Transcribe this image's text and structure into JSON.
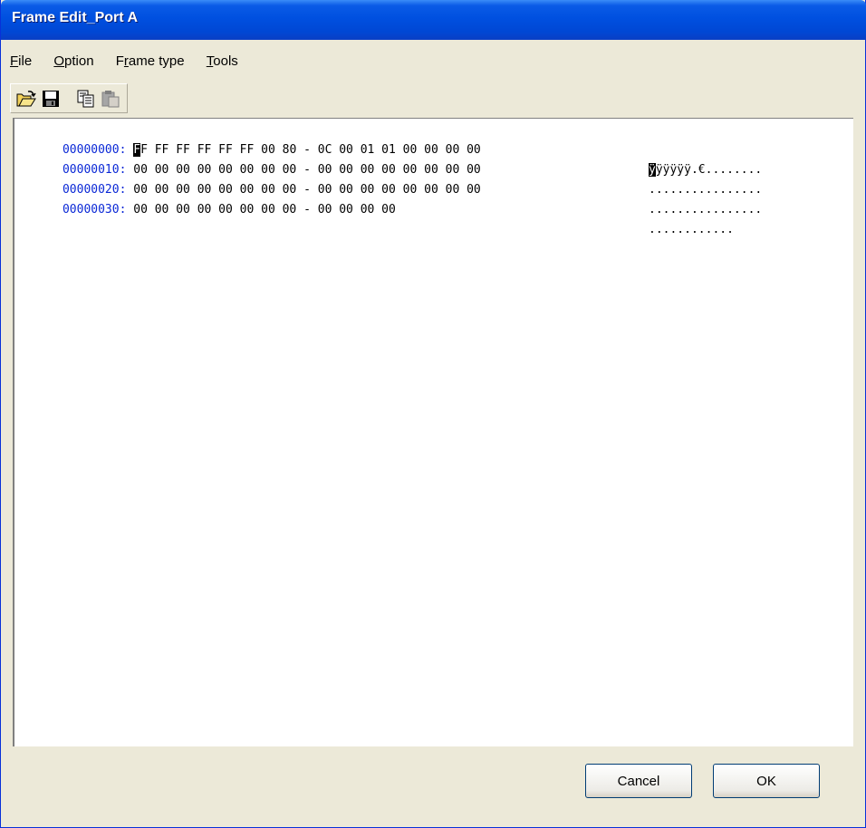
{
  "window": {
    "title": "Frame Edit_Port A"
  },
  "menu": [
    {
      "label_pre": "",
      "label_ul": "F",
      "label_post": "ile"
    },
    {
      "label_pre": "",
      "label_ul": "O",
      "label_post": "ption"
    },
    {
      "label_pre": "F",
      "label_ul": "r",
      "label_post": "ame type"
    },
    {
      "label_pre": "",
      "label_ul": "T",
      "label_post": "ools"
    }
  ],
  "toolbar": {
    "icons": [
      "open-folder-icon",
      "save-icon",
      "copy-icon",
      "paste-icon"
    ]
  },
  "hex_rows": [
    {
      "address": "00000000:",
      "cursor_char": "F",
      "hex": "F FF FF FF FF FF 00 80 - 0C 00 01 01 00 00 00 00",
      "ascii_cursor": "ÿ",
      "ascii": "ÿÿÿÿÿ.€........"
    },
    {
      "address": "00000010:",
      "cursor_char": "",
      "hex": "00 00 00 00 00 00 00 00 - 00 00 00 00 00 00 00 00",
      "ascii_cursor": "",
      "ascii": "................"
    },
    {
      "address": "00000020:",
      "cursor_char": "",
      "hex": "00 00 00 00 00 00 00 00 - 00 00 00 00 00 00 00 00",
      "ascii_cursor": "",
      "ascii": "................"
    },
    {
      "address": "00000030:",
      "cursor_char": "",
      "hex": "00 00 00 00 00 00 00 00 - 00 00 00 00",
      "ascii_cursor": "",
      "ascii": "............"
    }
  ],
  "buttons": {
    "cancel": "Cancel",
    "ok": "OK"
  },
  "colors": {
    "title_blue": "#0054e3",
    "address_blue": "#0a28d6",
    "window_bg": "#ece9d8"
  }
}
